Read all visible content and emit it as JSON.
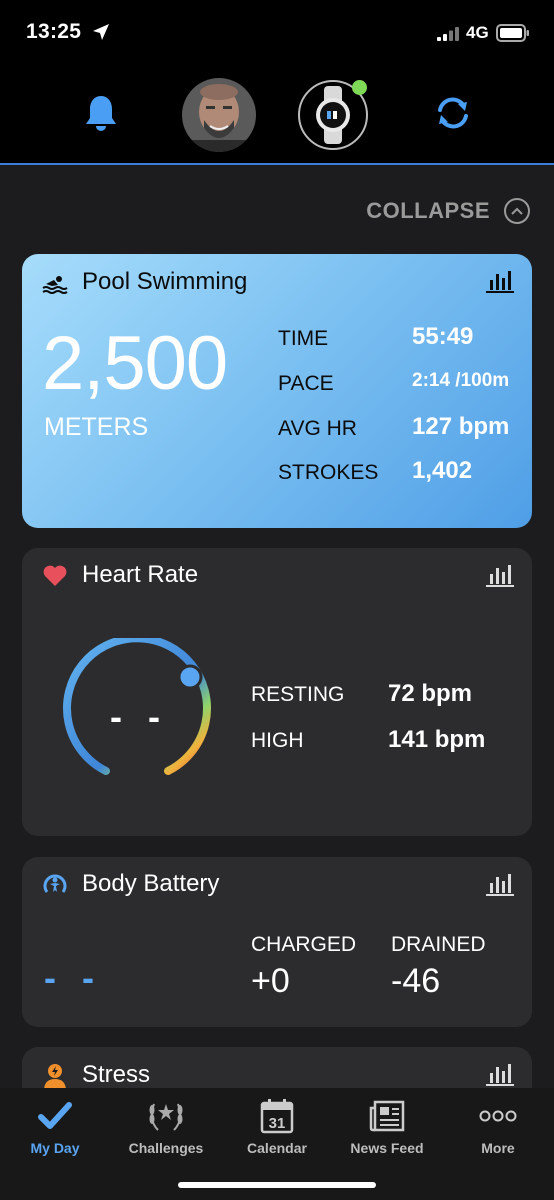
{
  "status_bar": {
    "time": "13:25",
    "network": "4G"
  },
  "header": {
    "notification_icon": "bell-icon",
    "sync_icon": "sync-icon",
    "device_status_color": "#7ed957"
  },
  "collapse": {
    "label": "COLLAPSE"
  },
  "pool_swimming": {
    "title": "Pool Swimming",
    "distance": "2,500",
    "unit": "METERS",
    "stats": [
      {
        "label": "TIME",
        "value": "55:49"
      },
      {
        "label": "PACE",
        "value": "2:14 /100m"
      },
      {
        "label": "AVG HR",
        "value": "127 bpm"
      },
      {
        "label": "STROKES",
        "value": "1,402"
      }
    ]
  },
  "heart_rate": {
    "title": "Heart Rate",
    "current": "- -",
    "stats": [
      {
        "label": "RESTING",
        "value": "72 bpm"
      },
      {
        "label": "HIGH",
        "value": "141 bpm"
      }
    ]
  },
  "body_battery": {
    "title": "Body Battery",
    "current": "- -",
    "charged_label": "CHARGED",
    "charged_value": "+0",
    "drained_label": "DRAINED",
    "drained_value": "-46"
  },
  "stress": {
    "title": "Stress"
  },
  "tabs": [
    {
      "label": "My Day",
      "icon": "checkmark-icon",
      "active": true
    },
    {
      "label": "Challenges",
      "icon": "laurel-icon",
      "active": false
    },
    {
      "label": "Calendar",
      "icon": "calendar-icon",
      "day": "31",
      "active": false
    },
    {
      "label": "News Feed",
      "icon": "newspaper-icon",
      "active": false
    },
    {
      "label": "More",
      "icon": "more-icon",
      "active": false
    }
  ],
  "colors": {
    "accent": "#5aa5f2",
    "heart": "#e8505b",
    "card": "#2c2c2e"
  }
}
